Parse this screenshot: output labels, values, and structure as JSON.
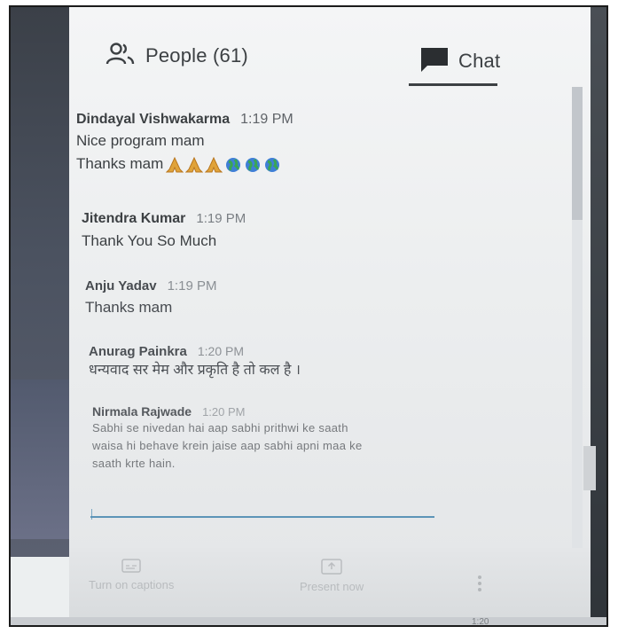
{
  "tabs": {
    "people": {
      "label": "People (61)",
      "icon": "people-icon"
    },
    "chat": {
      "label": "Chat",
      "icon": "chat-bubble-icon",
      "active": true
    }
  },
  "messages": [
    {
      "sender": "Dindayal Vishwakarma",
      "time": "1:19 PM",
      "lines": [
        "Nice program  mam",
        "Thanks mam"
      ],
      "emoji": [
        "folded-hands",
        "folded-hands",
        "folded-hands",
        "globe",
        "globe",
        "globe"
      ]
    },
    {
      "sender": "Jitendra Kumar",
      "time": "1:19 PM",
      "lines": [
        "Thank You So Much"
      ]
    },
    {
      "sender": "Anju Yadav",
      "time": "1:19 PM",
      "lines": [
        "Thanks mam"
      ]
    },
    {
      "sender": "Anurag Painkra",
      "time": "1:20 PM",
      "lines": [
        "धन्यवाद सर मेम और प्रकृति है तो कल है ।"
      ]
    },
    {
      "sender": "Nirmala Rajwade",
      "time": "1:20 PM",
      "lines": [
        "Sabhi se nivedan hai aap sabhi prithwi ke saath",
        "waisa hi behave krein jaise aap sabhi apni maa ke",
        "saath krte hain."
      ]
    }
  ],
  "bottom_bar": {
    "captions_label": "Turn on captions",
    "present_label": "Present now"
  },
  "taskbar": {
    "clock": "1:20"
  },
  "colors": {
    "accent_underline": "#5d94b8",
    "text": "#3c4043"
  }
}
